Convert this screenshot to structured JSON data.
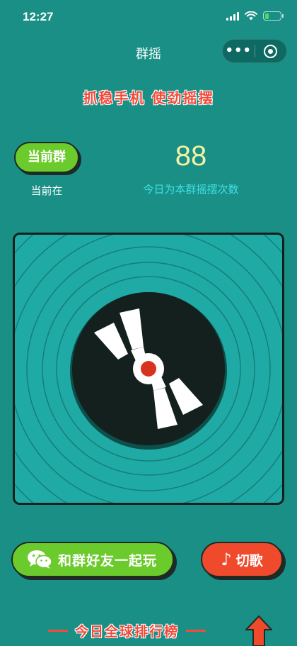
{
  "status_bar": {
    "time": "12:27",
    "battery_color": "#4cd964",
    "battery_level": 0.25
  },
  "nav": {
    "title": "群摇",
    "more_icon": "more-dots-icon",
    "close_icon": "target-circle-icon"
  },
  "slogan": "抓稳手机 使劲摇摆",
  "current_group": {
    "button_label": "当前群",
    "caption": "当前在"
  },
  "shake_count": {
    "value": "88",
    "caption": "今日为本群摇摆次数"
  },
  "actions": {
    "share_label": "和群好友一起玩",
    "share_icon": "wechat-icon",
    "switch_song_label": "切歌",
    "switch_song_icon": "music-note-icon"
  },
  "rank": {
    "label": "今日全球排行榜",
    "icon": "up-arrow-icon"
  },
  "colors": {
    "background": "#1a8f86",
    "panel": "#20aaa5",
    "green_button": "#6ccb2c",
    "red_button": "#f04a2c",
    "accent_red": "#f24a3b",
    "count_yellow": "#f4f2a3",
    "caption_cyan": "#3fe0e6"
  }
}
